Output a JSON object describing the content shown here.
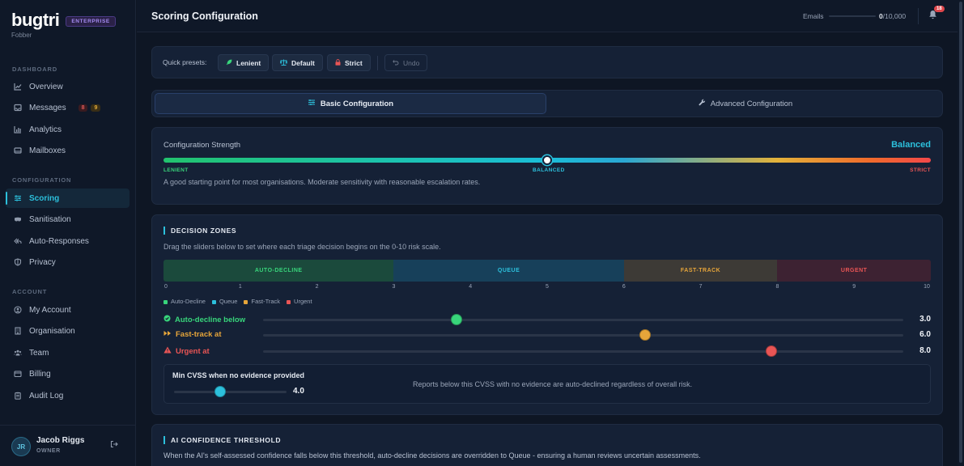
{
  "brand": {
    "logo": "bugtri",
    "badge": "ENTERPRISE",
    "org": "Fobber"
  },
  "sidebar": {
    "sections": [
      "DASHBOARD",
      "CONFIGURATION",
      "ACCOUNT"
    ],
    "items": [
      {
        "label": "Overview",
        "icon": "chart-line-icon"
      },
      {
        "label": "Messages",
        "icon": "inbox-icon",
        "badges": [
          "8",
          "9"
        ]
      },
      {
        "label": "Analytics",
        "icon": "bar-chart-icon"
      },
      {
        "label": "Mailboxes",
        "icon": "mailbox-icon"
      },
      {
        "label": "Scoring",
        "icon": "sliders-icon",
        "active": true
      },
      {
        "label": "Sanitisation",
        "icon": "mask-icon"
      },
      {
        "label": "Auto-Responses",
        "icon": "reply-all-icon"
      },
      {
        "label": "Privacy",
        "icon": "shield-icon"
      },
      {
        "label": "My Account",
        "icon": "user-circle-icon"
      },
      {
        "label": "Organisation",
        "icon": "building-icon"
      },
      {
        "label": "Team",
        "icon": "users-icon"
      },
      {
        "label": "Billing",
        "icon": "wallet-icon"
      },
      {
        "label": "Audit Log",
        "icon": "clipboard-icon"
      }
    ],
    "user": {
      "initials": "JR",
      "name": "Jacob Riggs",
      "role": "OWNER"
    }
  },
  "header": {
    "title": "Scoring Configuration",
    "emails_label": "Emails",
    "emails_used": "0",
    "emails_limit": "/10,000",
    "emails_usage": 0,
    "notifications": "18"
  },
  "presets": {
    "label": "Quick presets:",
    "lenient": "Lenient",
    "default": "Default",
    "strict": "Strict",
    "undo": "Undo"
  },
  "tabs": {
    "basic": "Basic Configuration",
    "advanced": "Advanced Configuration",
    "active": "basic"
  },
  "strength": {
    "label": "Configuration Strength",
    "value": "Balanced",
    "position": 0.5,
    "scale_left": "LENIENT",
    "scale_mid": "BALANCED",
    "scale_right": "STRICT",
    "description": "A good starting point for most organisations. Moderate sensitivity with reasonable escalation rates."
  },
  "zones": {
    "title": "DECISION ZONES",
    "description": "Drag the sliders below to set where each triage decision begins on the 0-10 risk scale.",
    "bands": [
      {
        "label": "AUTO-DECLINE",
        "from": 0,
        "to": 3
      },
      {
        "label": "QUEUE",
        "from": 3,
        "to": 6
      },
      {
        "label": "FAST-TRACK",
        "from": 6,
        "to": 8
      },
      {
        "label": "URGENT",
        "from": 8,
        "to": 10
      }
    ],
    "ticks": [
      "0",
      "1",
      "2",
      "3",
      "4",
      "5",
      "6",
      "7",
      "8",
      "9",
      "10"
    ],
    "legend": [
      "Auto-Decline",
      "Queue",
      "Fast-Track",
      "Urgent"
    ],
    "colors": {
      "decline": "#38d57b",
      "queue": "#2cc0dc",
      "fast": "#e6a53a",
      "urgent": "#e95555"
    },
    "sliders": [
      {
        "label": "Auto-decline below",
        "value": "3.0",
        "icon": "check-circle-icon"
      },
      {
        "label": "Fast-track at",
        "value": "6.0",
        "icon": "fast-forward-icon"
      },
      {
        "label": "Urgent at",
        "value": "8.0",
        "icon": "warning-triangle-icon"
      }
    ],
    "cvss": {
      "title": "Min CVSS when no evidence provided",
      "value": "4.0",
      "description": "Reports below this CVSS with no evidence are auto-declined regardless of overall risk."
    }
  },
  "ai": {
    "title": "AI CONFIDENCE THRESHOLD",
    "description": "When the AI's self-assessed confidence falls below this threshold, auto-decline decisions are overridden to Queue - ensuring a human reviews uncertain assessments."
  }
}
